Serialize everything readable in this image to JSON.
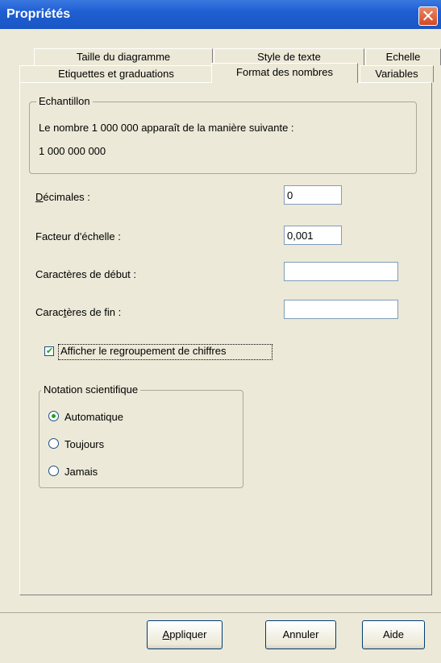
{
  "window": {
    "title": "Propriétés"
  },
  "tabs": {
    "row_back": [
      "Taille du diagramme",
      "Style de texte",
      "Echelle"
    ],
    "row_front": [
      "Etiquettes et graduations",
      "Format des nombres",
      "Variables"
    ],
    "active": "Format des nombres"
  },
  "sample": {
    "legend": "Echantillon",
    "line1": "Le nombre 1 000 000 apparaît de la manière suivante :",
    "line2": "1 000 000 000"
  },
  "fields": {
    "decimals_label": "Décimales :",
    "decimals_value": "0",
    "scale_label": "Facteur d'échelle :",
    "scale_value": "0,001",
    "prefix_label": "Caractères de début :",
    "prefix_value": "",
    "suffix_label": "Caractères de fin :",
    "suffix_value": ""
  },
  "grouping": {
    "label": "Afficher le regroupement de chiffres",
    "checked": true
  },
  "scientific": {
    "legend": "Notation scientifique",
    "options": [
      "Automatique",
      "Toujours",
      "Jamais"
    ],
    "selected": "Automatique"
  },
  "buttons": {
    "apply": "Appliquer",
    "cancel": "Annuler",
    "help": "Aide"
  }
}
